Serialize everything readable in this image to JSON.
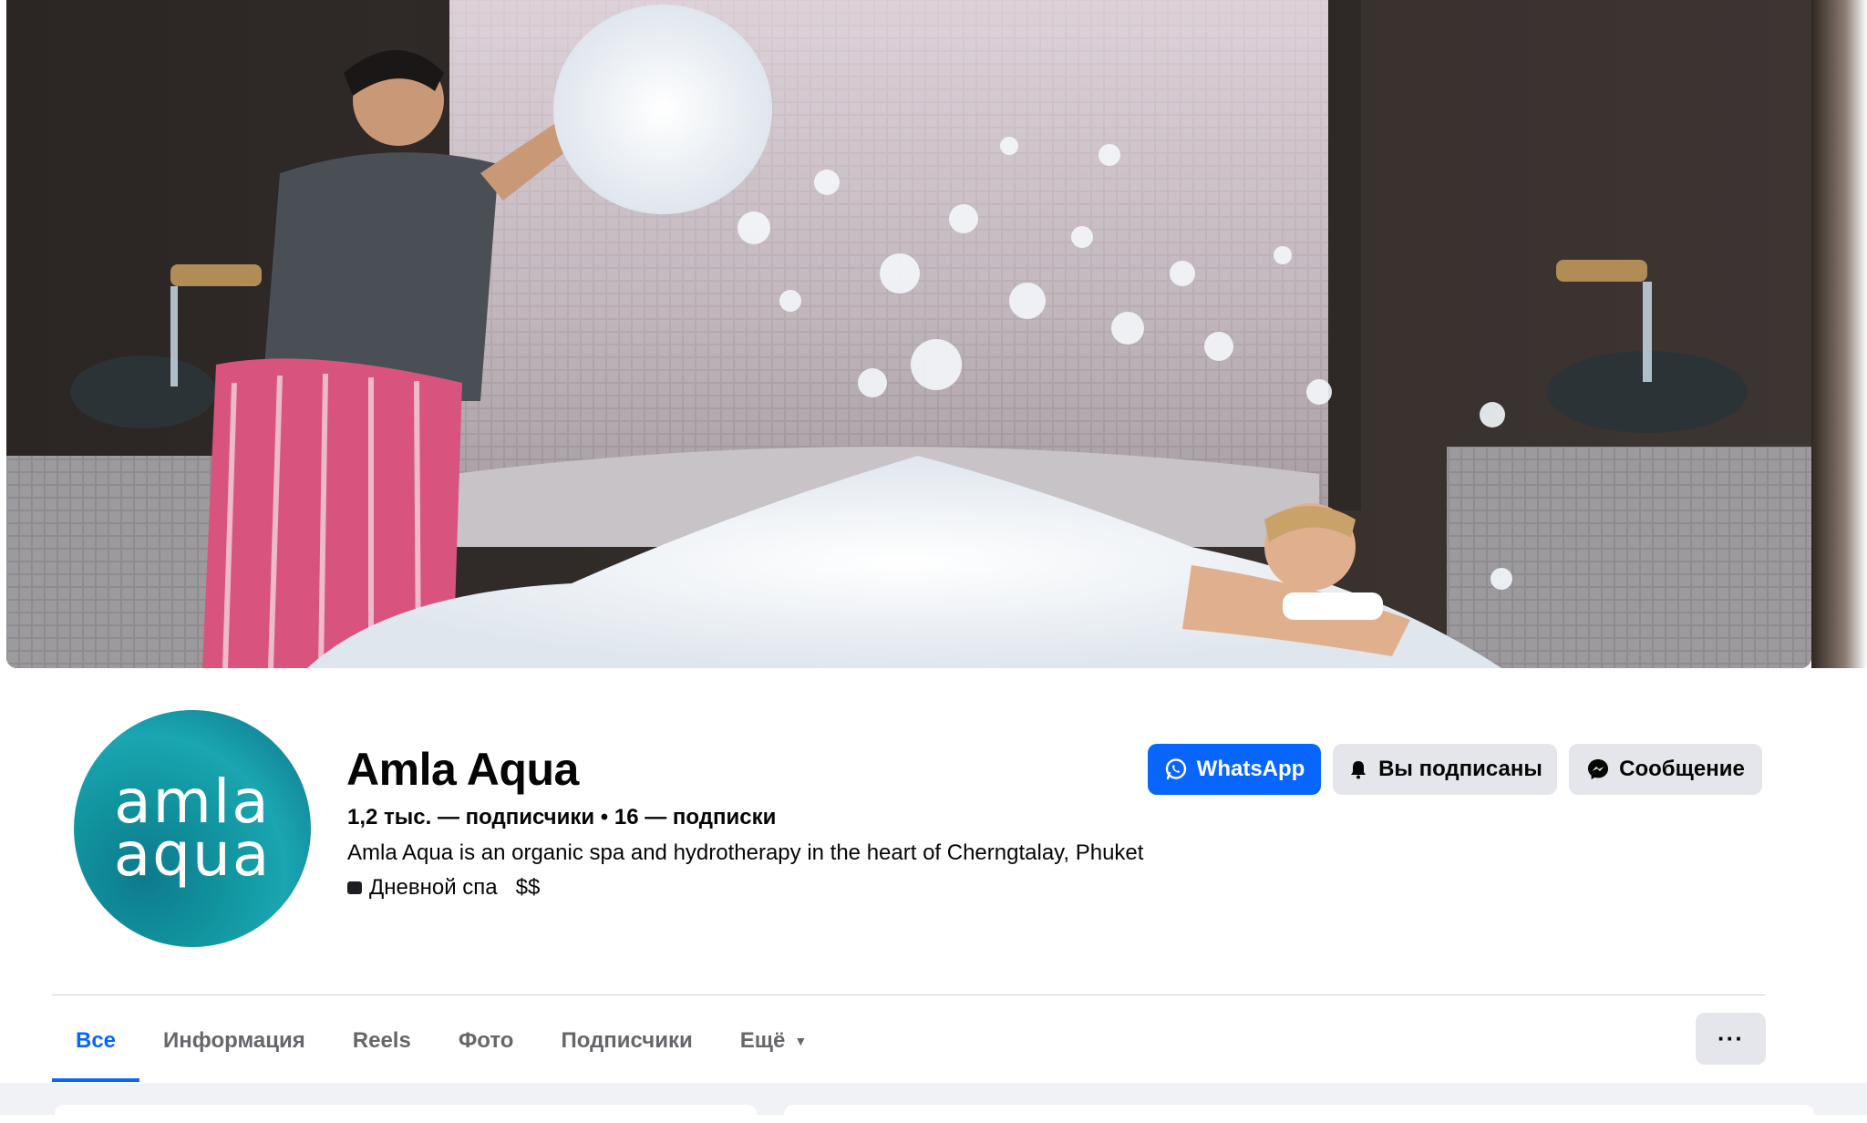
{
  "cover": {
    "alt_icon": "spa-cover-photo"
  },
  "profile": {
    "avatar_line1": "amla",
    "avatar_line2": "aqua",
    "name": "Amla Aqua",
    "stats": "1,2 тыс. — подписчики • 16 — подписки",
    "description": "Amla Aqua is an organic spa and hydrotherapy in the heart of Cherngtalay, Phuket",
    "category": "Дневной спа",
    "price": "$$"
  },
  "actions": {
    "whatsapp_label": "WhatsApp",
    "subscribed_label": "Вы подписаны",
    "message_label": "Сообщение"
  },
  "tabs": [
    {
      "label": "Все",
      "active": true
    },
    {
      "label": "Информация",
      "active": false
    },
    {
      "label": "Reels",
      "active": false
    },
    {
      "label": "Фото",
      "active": false
    },
    {
      "label": "Подписчики",
      "active": false
    },
    {
      "label": "Ещё",
      "active": false
    }
  ],
  "more_button": "···",
  "colors": {
    "accent": "#0866ff",
    "button_gray": "#e4e6eb",
    "text": "#050505",
    "muted": "#65676b",
    "avatar_teal": "#11959f"
  }
}
